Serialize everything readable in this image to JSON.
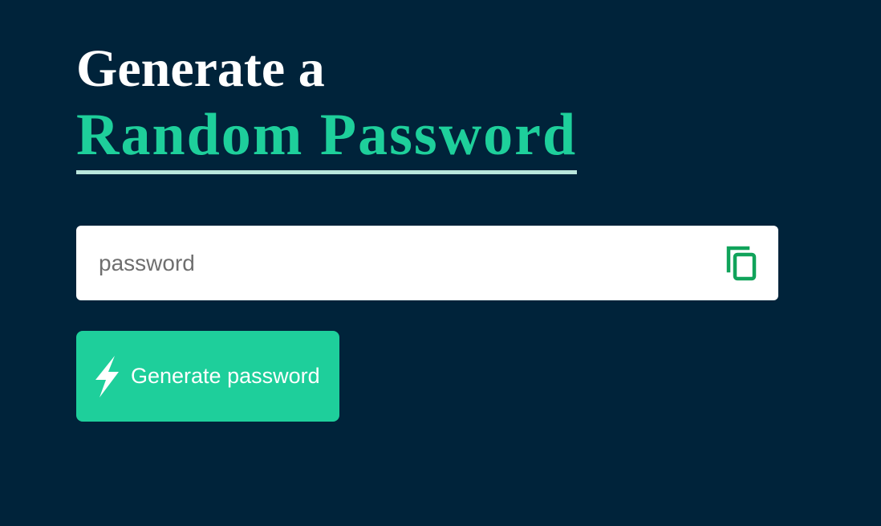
{
  "hero": {
    "line1": "Generate a",
    "line2": "Random Password"
  },
  "password_field": {
    "value": "",
    "placeholder": "password",
    "copy_icon": "copy-icon"
  },
  "generate_button": {
    "label": "Generate password",
    "icon": "lightning-bolt-icon"
  },
  "colors": {
    "background": "#00233a",
    "accent": "#1ecf9b",
    "underline": "#b9e6dc",
    "copy_icon": "#10a35a"
  }
}
